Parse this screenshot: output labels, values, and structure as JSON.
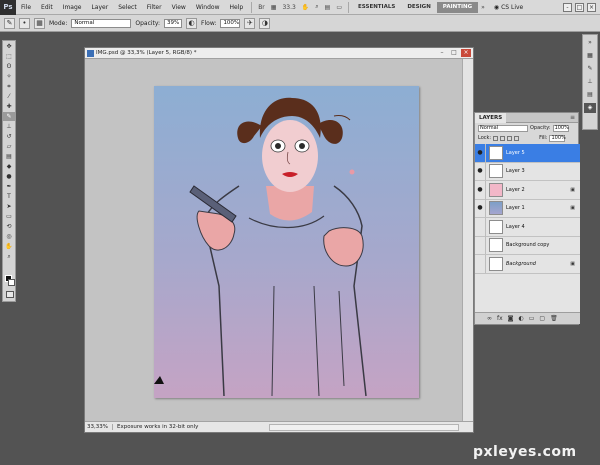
{
  "app": {
    "logo": "Ps"
  },
  "menu": [
    "File",
    "Edit",
    "Image",
    "Layer",
    "Select",
    "Filter",
    "View",
    "Window",
    "Help"
  ],
  "menu_extra": {
    "zoom_readout": "33.3"
  },
  "workspaces": [
    "ESSENTIALS",
    "DESIGN",
    "PAINTING"
  ],
  "active_workspace": "PAINTING",
  "cs_live": "CS Live",
  "window_controls": [
    "-",
    "□",
    "×"
  ],
  "options": {
    "mode_label": "Mode:",
    "mode_value": "Normal",
    "opacity_label": "Opacity:",
    "opacity_value": "39%",
    "flow_label": "Flow:",
    "flow_value": "100%"
  },
  "document": {
    "title": "IMG.psd @ 33,3% (Layer 5, RGB/8) *",
    "zoom": "33,33%",
    "status": "Exposure works in 32-bit only"
  },
  "layers_panel": {
    "tab": "LAYERS",
    "blend_mode": "Normal",
    "opacity_label": "Opacity:",
    "opacity_value": "100%",
    "lock_label": "Lock:",
    "fill_label": "Fill:",
    "fill_value": "100%",
    "layers": [
      {
        "name": "Layer 5",
        "visible": true,
        "selected": true,
        "thumb": "sketch"
      },
      {
        "name": "Layer 3",
        "visible": true,
        "selected": false,
        "thumb": "sketch"
      },
      {
        "name": "Layer 2",
        "visible": true,
        "selected": false,
        "thumb": "pink",
        "locked": true
      },
      {
        "name": "Layer 1",
        "visible": true,
        "selected": false,
        "thumb": "blue",
        "locked": true
      },
      {
        "name": "Layer 4",
        "visible": false,
        "selected": false,
        "thumb": "blank"
      },
      {
        "name": "Background copy",
        "visible": false,
        "selected": false,
        "thumb": "sketch"
      },
      {
        "name": "Background",
        "visible": false,
        "selected": false,
        "thumb": "sketch",
        "locked": true,
        "italic": true
      }
    ]
  },
  "watermark": "pxleyes.com",
  "colors": {
    "canvas_top": "#8daed3",
    "canvas_bottom": "#c5a3c4",
    "selection": "#3a7ee4"
  }
}
